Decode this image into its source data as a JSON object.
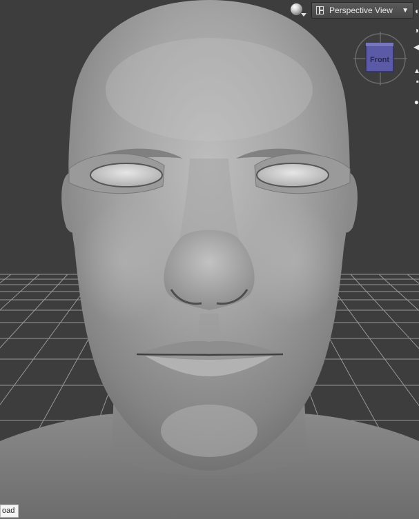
{
  "viewport": {
    "view_selector_label": "Perspective View",
    "view_selector_caret": "▼",
    "shading_icon": "sphere-shading-icon",
    "cube_face_label": "Front",
    "cube_face_color": "#5a5aa6",
    "background_color": "#3d3d3d",
    "grid_color": "#a9a9a9",
    "model_color": "#9c9c9c"
  },
  "tooltip": {
    "text": "oad"
  }
}
